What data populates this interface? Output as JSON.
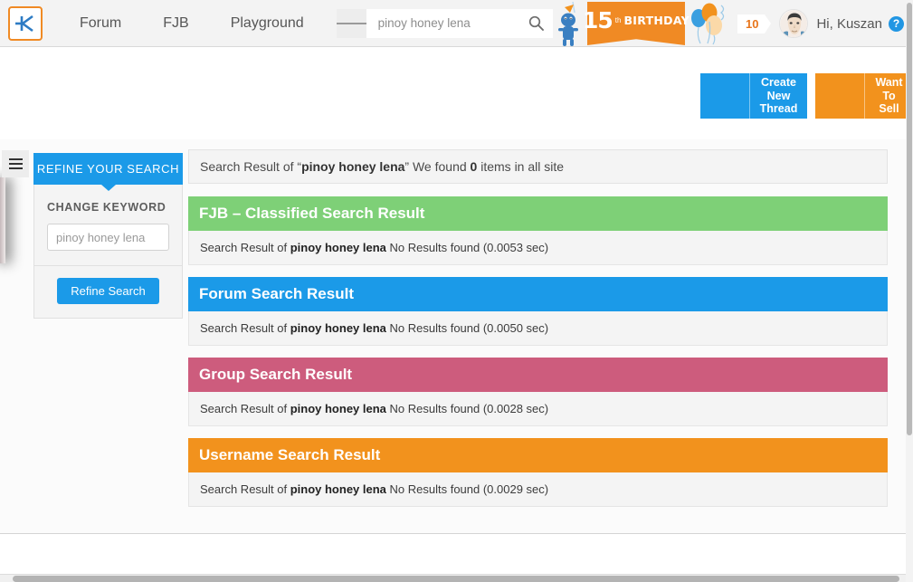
{
  "header": {
    "logo_icon": "k-logo-icon",
    "nav_links": [
      {
        "label": "Forum"
      },
      {
        "label": "FJB"
      },
      {
        "label": "Playground"
      }
    ],
    "search": {
      "filter_icon": "hamburger-filter-icon",
      "value": "",
      "placeholder": "pinoy honey lena",
      "submit_icon": "search-icon"
    },
    "mascot_icon": "mascot-icon",
    "banner": {
      "number": "15",
      "superscript": "th",
      "word": "BIRTHDAY",
      "decor_icon": "ribbon-banner-icon"
    },
    "balloons_icon": "balloons-icon",
    "notification_count": "10",
    "avatar_icon": "user-avatar",
    "greeting": "Hi, Kuszan",
    "help_icon": "help-question-icon"
  },
  "actions": [
    {
      "label": "Create New Thread",
      "icon": "new-thread-icon",
      "color": "#1b9ae8"
    },
    {
      "label": "Want To Sell",
      "icon": "sell-tag-icon",
      "color": "#f2921d"
    }
  ],
  "offcanvas": {
    "toggle_icon": "offcanvas-menu-icon"
  },
  "sidebar": {
    "tab_label": "REFINE YOUR SEARCH",
    "change_keyword_label": "CHANGE KEYWORD",
    "keyword_value": "",
    "keyword_placeholder": "pinoy honey lena",
    "refine_button_label": "Refine Search"
  },
  "main": {
    "summary": {
      "prefix": "Search Result of “",
      "query": "pinoy honey lena",
      "middle": "” We found ",
      "count": "0",
      "suffix": " items in all site"
    },
    "sections": [
      {
        "title": "FJB – Classified Search Result",
        "color": "#7ed077",
        "body_prefix": "Search Result of ",
        "query": "pinoy honey lena",
        "body_suffix": " No Results found (0.0053 sec)",
        "time": "0.0053"
      },
      {
        "title": "Forum Search Result",
        "color": "#1b9ae8",
        "body_prefix": "Search Result of ",
        "query": "pinoy honey lena",
        "body_suffix": " No Results found (0.0050 sec)",
        "time": "0.0050"
      },
      {
        "title": "Group Search Result",
        "color": "#cd5c7d",
        "body_prefix": "Search Result of ",
        "query": "pinoy honey lena",
        "body_suffix": " No Results found (0.0028 sec)",
        "time": "0.0028"
      },
      {
        "title": "Username Search Result",
        "color": "#f2921d",
        "body_prefix": "Search Result of ",
        "query": "pinoy honey lena",
        "body_suffix": " No Results found (0.0029 sec)",
        "time": "0.0029"
      }
    ]
  }
}
